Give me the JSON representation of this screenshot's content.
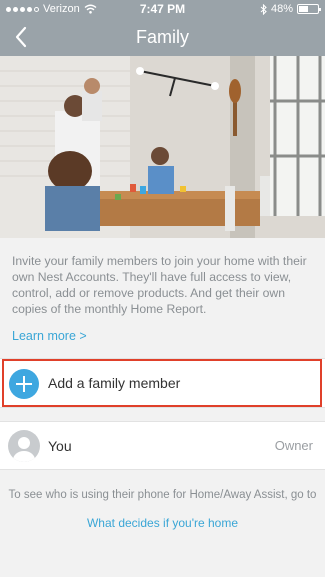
{
  "status_bar": {
    "carrier": "Verizon",
    "time": "7:47 PM",
    "battery": "48%",
    "battery_level": 0.48,
    "signal_filled": 4,
    "signal_total": 5
  },
  "header": {
    "title": "Family",
    "back_icon": "chevron-left-icon"
  },
  "intro": {
    "text": "Invite your family members to join your home with their own Nest Accounts. They'll have full access to view, control, add or remove products. And get their own copies of the monthly Home Report.",
    "learn_more": "Learn more >"
  },
  "add_member": {
    "label": "Add a family member",
    "icon": "plus-icon",
    "accent": "#3ea7e0",
    "highlight_color": "#e0402a"
  },
  "members": [
    {
      "name": "You",
      "role": "Owner"
    }
  ],
  "footer": {
    "text": "To see who is using their phone for Home/Away Assist, go to",
    "link": "What decides if you're home"
  },
  "colors": {
    "header": "#9aa3a9",
    "link": "#3aa6d6",
    "background": "#f2f2f2"
  }
}
